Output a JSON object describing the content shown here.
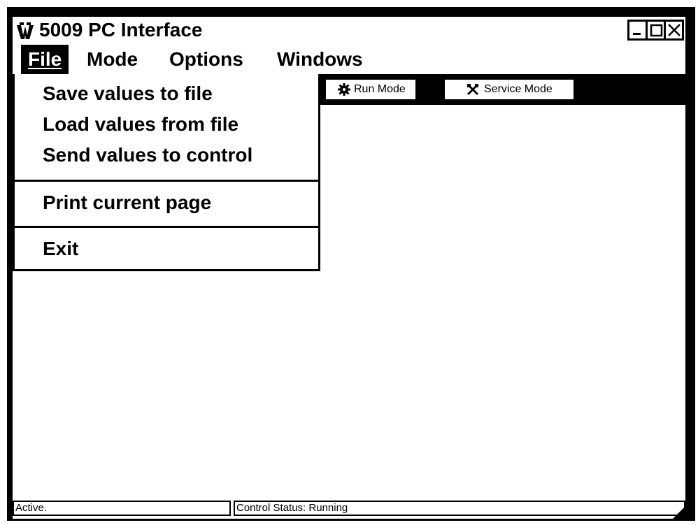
{
  "window": {
    "title": "5009 PC Interface",
    "app_icon": "woodward-logo-icon",
    "controls": [
      "minimize-icon",
      "maximize-icon",
      "close-icon"
    ]
  },
  "menubar": {
    "items": [
      {
        "label": "File",
        "active": true
      },
      {
        "label": "Mode"
      },
      {
        "label": "Options"
      },
      {
        "label": "Windows"
      }
    ]
  },
  "toolbar": {
    "buttons": [
      {
        "label": "Run Mode",
        "icon": "gear-icon"
      },
      {
        "label": "Service Mode",
        "icon": "wrench-icon"
      }
    ]
  },
  "file_menu": {
    "items": [
      {
        "label": "Save values to file",
        "group": 1
      },
      {
        "label": "Load values from file",
        "group": 1
      },
      {
        "label": "Send values to control",
        "group": 1
      },
      {
        "label": "Print current page",
        "group": 2
      },
      {
        "label": "Exit",
        "group": 3
      }
    ]
  },
  "statusbar": {
    "active_text": "Active.",
    "control_status": "Control Status:  Running"
  },
  "colors": {
    "frame": "#000000",
    "background": "#ffffff",
    "text": "#000000"
  }
}
